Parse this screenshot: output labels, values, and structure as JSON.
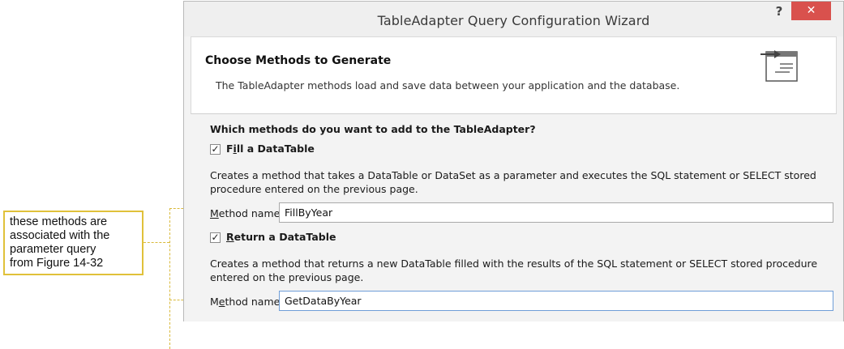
{
  "callout": {
    "lines": [
      "these methods are",
      "associated with the",
      "parameter query",
      "from Figure 14-32"
    ]
  },
  "window": {
    "title": "TableAdapter Query Configuration Wizard",
    "help_label": "?",
    "close_label": "✕"
  },
  "header": {
    "title": "Choose Methods to Generate",
    "subtitle": "The TableAdapter methods load and save data between your application and the database.",
    "icon": "wizard-table-arrow-icon"
  },
  "question": "Which methods do you want to add to the TableAdapter?",
  "fill": {
    "checked": true,
    "label_prefix": "F",
    "label_underlined": "i",
    "label_rest": "ll a DataTable",
    "description_line1": "Creates a method that takes a DataTable or DataSet as a parameter and executes the SQL statement or SELECT stored",
    "description_line2": "procedure entered on the previous page.",
    "method_label_underlined": "M",
    "method_label_rest": "ethod name:",
    "method_value": "FillByYear"
  },
  "return": {
    "checked": true,
    "label_underlined": "R",
    "label_rest": "eturn a DataTable",
    "description_line1": "Creates a method that returns a new DataTable filled with the results of the SQL statement or SELECT stored procedure",
    "description_line2": "entered on the previous page.",
    "method_label_prefix": "M",
    "method_label_underlined": "e",
    "method_label_rest": "thod name:",
    "method_value": "GetDataByYear"
  },
  "colors": {
    "close_button": "#d9514d",
    "callout_border": "#e0c13a",
    "focus_border": "#6f9ed8"
  }
}
